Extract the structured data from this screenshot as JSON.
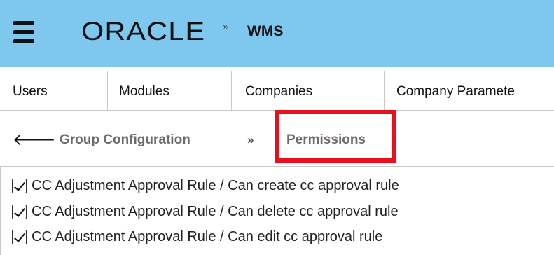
{
  "header": {
    "brand": "ORACLE",
    "brand_mark": "®",
    "app_name": "WMS",
    "menu_icon": "hamburger-menu-icon",
    "background": "#7ec8f0"
  },
  "tabs": [
    {
      "label": "Users"
    },
    {
      "label": "Modules"
    },
    {
      "label": "Companies"
    },
    {
      "label": "Company Paramete"
    }
  ],
  "breadcrumb": {
    "back_icon": "back-arrow-icon",
    "back_glyph": "🡐",
    "parent": "Group Configuration",
    "separator_glyph": "»",
    "current": "Permissions",
    "highlight_color": "#e8101c"
  },
  "permissions": [
    {
      "label": "CC Adjustment Approval Rule / Can create cc approval rule",
      "checked": true
    },
    {
      "label": "CC Adjustment Approval Rule / Can delete cc approval rule",
      "checked": true
    },
    {
      "label": "CC Adjustment Approval Rule / Can edit cc approval rule",
      "checked": true
    }
  ]
}
